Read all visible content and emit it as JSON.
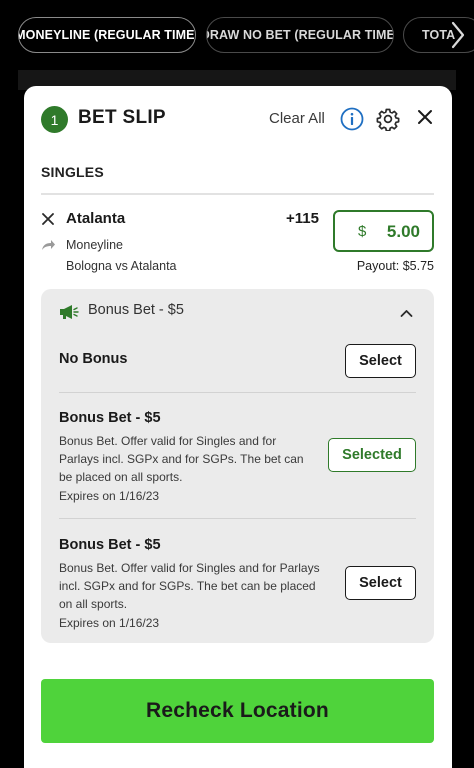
{
  "filters": {
    "tabs": [
      {
        "label": "MONEYLINE (REGULAR TIME)"
      },
      {
        "label": "DRAW NO BET (REGULAR TIME)"
      },
      {
        "label": "TOTA"
      }
    ]
  },
  "bet_slip": {
    "count": "1",
    "title": "BET SLIP",
    "clear_all_label": "Clear All",
    "section_label": "SINGLES",
    "selection": {
      "team": "Atalanta",
      "odds": "+115",
      "market": "Moneyline",
      "event": "Bologna vs Atalanta",
      "stake_currency": "$",
      "stake_amount": "5.00",
      "payout": "Payout: $5.75"
    },
    "bonus": {
      "header": "Bonus Bet - $5",
      "options": [
        {
          "title": "No Bonus",
          "button": "Select"
        },
        {
          "title": "Bonus Bet - $5",
          "description": "Bonus Bet. Offer valid for Singles and for Parlays incl. SGPx and for SGPs. The bet can be placed on all sports.",
          "expires": "Expires on 1/16/23",
          "button": "Selected"
        },
        {
          "title": "Bonus Bet - $5",
          "description": "Bonus Bet. Offer valid for Singles and for Parlays incl. SGPx and for SGPs. The bet can be placed on all sports.",
          "expires": "Expires on 1/16/23",
          "button": "Select"
        }
      ]
    },
    "primary_button": "Recheck Location"
  },
  "colors": {
    "accent_green": "#2f7a2a",
    "cta_green": "#4fd33b",
    "background": "#000000",
    "info_blue": "#1f6fc2"
  },
  "icons": [
    "chevron-right-icon",
    "info-icon",
    "gear-icon",
    "close-icon",
    "remove-icon",
    "share-arrow-icon",
    "megaphone-icon",
    "chevron-up-icon"
  ]
}
